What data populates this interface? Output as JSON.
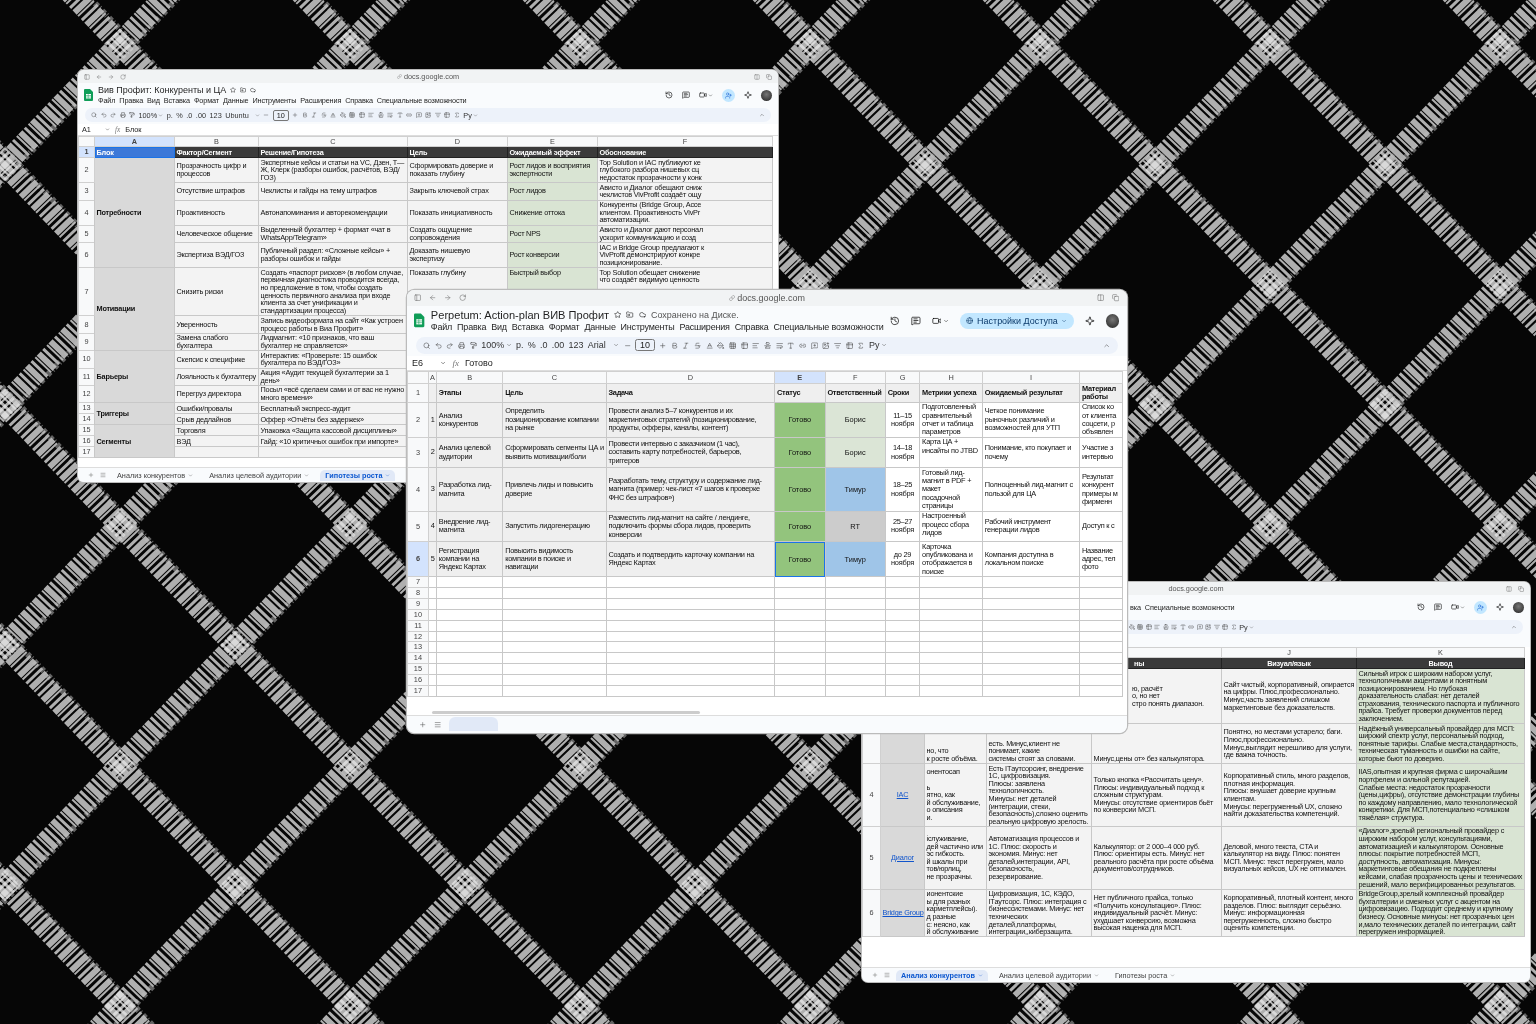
{
  "competitors_window": {
    "url": "docs.google.com",
    "title": "Вив Профит: Конкуренты и ЦА",
    "menu": [
      "Файл",
      "Правка",
      "Вид",
      "Вставка",
      "Формат",
      "Данные",
      "Инструменты",
      "Расширения",
      "Справка",
      "Специальные возможности"
    ],
    "toolbar": {
      "zoom": "100%",
      "formats": [
        "р.",
        "%",
        ".0",
        ".00",
        "123"
      ],
      "font": "Ubuntu",
      "size": "10",
      "input": "Ру"
    },
    "formula": {
      "cell": "A1",
      "function": "fx",
      "value": "Блок"
    },
    "columns": [
      {
        "letter": "A",
        "selected": true
      },
      {
        "letter": "B",
        "selected": false
      },
      {
        "letter": "C",
        "selected": false
      },
      {
        "letter": "D",
        "selected": false
      },
      {
        "letter": "E",
        "selected": false
      },
      {
        "letter": "F",
        "selected": false
      }
    ],
    "header": {
      "number": "1",
      "selected": true,
      "cells": [
        "Блок",
        "Фактор/Сегмент",
        "Решение/Гипотеза",
        "Цель",
        "Ожидаемый эффект",
        "Обоснование"
      ]
    },
    "groups": [
      {
        "block": "Потребности",
        "rows": [
          {
            "number": "2",
            "cells": [
              "Прозрачность цифр и процессов",
              "Экспертные кейсы и статьи на VC, Дзен, Т—Ж, Клерк (разборы ошибок, расчётов, ВЭД/ГОЗ)",
              "Сформировать доверие и показать глубину",
              "Рост лидов и восприятия экспертности",
              "Top Solution и IAC публикуют ке\nглубокого разбора нишевых сц\nнедостаток прозрачности у конк"
            ]
          },
          {
            "number": "3",
            "cells": [
              "Отсутствие штрафов",
              "Чеклисты и гайды на тему штрафов",
              "Закрыть ключевой страх",
              "Рост лидов",
              "Ависто и Диалог обещают сниж\nчеклистов VivProfit создаёт ощу"
            ]
          },
          {
            "number": "4",
            "cells": [
              "Проактивность",
              "Автонапоминания и авторекомендации",
              "Показать инициативность",
              "Снижение оттока",
              "Конкуренты (Bridge Group, Acce\nклиентом. Проактивность VivPr\nавтоматизации."
            ]
          },
          {
            "number": "5",
            "cells": [
              "Человеческое общение",
              "Выделенный бухгалтер + формат «чат в WhatsApp/Telegram»",
              "Создать ощущение сопровождения",
              "Рост NPS",
              "Ависто и Диалог дают персонал\nускорит коммуникацию и созд"
            ]
          },
          {
            "number": "6",
            "cells": [
              "Экспертиза ВЭД/ГОЗ",
              "Публичный раздел: «Сложные кейсы» + разборы ошибок и гайды",
              "Доказать нишевую экспертизу",
              "Рост конверсии",
              "IAC и Bridge Group предлагают к\nVivProfit демонстрируют конкре\nпозиционирование."
            ]
          }
        ]
      },
      {
        "block": "Мотивации",
        "rows": [
          {
            "number": "7",
            "cells": [
              "Снизить риски",
              "Создать «паспорт рисков» (в любом случае, первичная диагностика проводится всегда, но предложение в том, чтобы создать ценность первичного анализа при входе клиента за счет унификации и стандартизации процесса)",
              "Показать глубину",
              "Быстрый выбор",
              "Top Solution обещает снижение\nчто создаёт видимую ценность"
            ]
          },
          {
            "number": "8",
            "cells": [
              "Уверенность",
              "Запись видеоформата на сайт «Как устроен процесс работы в Виа Профит»"
            ]
          },
          {
            "number": "9",
            "cells": [
              "Замена слабого бухгалтера",
              "Лидмагнит: «10 признаков, что ваш бухгалтер не справляется»"
            ]
          }
        ]
      },
      {
        "block": "Барьеры",
        "rows": [
          {
            "number": "10",
            "cells": [
              "Скепсис к специфике",
              "Интерактив: «Проверьте: 15 ошибок бухгалтера по ВЭД/ГОЗ»"
            ]
          },
          {
            "number": "11",
            "cells": [
              "Лояльность к бухгалтеру",
              "Акция «Аудит текущей бухгалтерии за 1 день»"
            ]
          },
          {
            "number": "12",
            "cells": [
              "Перегруз директора",
              "Посыл «всё сделаем сами и от вас не нужно много времени»"
            ]
          }
        ]
      },
      {
        "block": "Триггеры",
        "rows": [
          {
            "number": "13",
            "cells": [
              "Ошибки/провалы",
              "Бесплатный экспресс-аудит"
            ]
          },
          {
            "number": "14",
            "cells": [
              "Срыв дедлайнов",
              "Оффер «Отчёты без задержек»"
            ]
          }
        ]
      },
      {
        "block": "Сегменты",
        "rows": [
          {
            "number": "15",
            "cells": [
              "Торговля",
              "Упаковка «Защита кассовой дисциплины»"
            ]
          },
          {
            "number": "16",
            "cells": [
              "ВЭД",
              "Гайд: «10 критичных ошибок при импорте»"
            ]
          },
          {
            "number": "17",
            "cells": []
          }
        ]
      }
    ],
    "tabs": [
      {
        "label": "Анализ конкурентов",
        "selected": false
      },
      {
        "label": "Анализ целевой аудитории",
        "selected": false
      },
      {
        "label": "Гипотезы роста",
        "selected": true
      }
    ]
  },
  "analysis_window": {
    "url": "docs.google.com",
    "menu": [
      "вка",
      "Специальные возможности"
    ],
    "toolbar": {
      "input": "Ру"
    },
    "column_letters": [
      "J",
      "K"
    ],
    "header": [
      "ны",
      "Визуал/язык",
      "Вывод"
    ],
    "rows": [
      {
        "cells": [
          null,
          null,
          "ю, расчёт\nо, но нет\nстро понять диапазон.",
          "Сайт чистый, корпоративный, опирается на цифры. Плюс,профессионально. Минус,часть заявлений слишком маркетинговые без доказательств.",
          "Сильный игрок с широким набором услуг, технологичными акцентами и понятным позиционированием. Но глубокая доказательность слабая: нет деталей страхования, технического паспорта и публичного прайса. Требует проверки документов перед заключением."
        ]
      },
      {
        "cells": [
          "но, что\nк росте объёма.",
          "есть. Минус,клиент не понимает, какие\nсистемы стоят за словами.",
          "Минус,цены от» без калькулятора.",
          "Понятно, но местами устарело; баги. Плюс,профессионально. Минус,выглядит нерешливо для услуги, где важна точность.",
          "Надёжный универсальный провайдер для МСП: широкий спектр услуг, персональный подход, понятные тарифы. Слабые места,стандартность, техническая туманность и ошибки на сайте, которые бьют по доверию."
        ]
      },
      {
        "number": "4",
        "name": "IAC",
        "cells": [
          "онентосап\n\nь\nятно, как\nй обслуживание,\nо описания\nи.",
          "Есть ITаутсорсинг, внедрение 1С, цифровизация.\nПлюсы: заявлена технологичность.\nМинусы: нет деталей (интеграции, стеки, безопасность),сложно оценить реальную цифровую зрелость.",
          "Только кнопка «Рассчитать цену».\nПлюсы: индивидуальный подход к сложным структурам.\nМинусы: отсутствие ориентиров бьёт по конверсии МСП.",
          "Корпоративный стиль, много разделов, плотная информация.\nПлюсы: внушает доверие крупным клиентам.\nМинусы: перегруженный UX, сложно найти доказательства компетенций.",
          "IIAS,опытная и крупная фирма с широчайшим портфелем и сильной репутацией.\nСлабые места: недостаток прозрачности (цены,цифры), отсутствие демонстрации глубины по каждому направлению, мало технологической конкретики. Для МСП,потенциально «слишком тяжёлая» структура."
        ]
      },
      {
        "number": "5",
        "name": "Диалог",
        "cells": [
          "іслуживание,\nдей частично или\nэс гибкость.\nй шкалы при\nтов/юрлиц,\nне прозрачны.",
          "Автоматизация процессов и 1С. Плюс: скорость и экономия. Минус: нет деталей,интеграции, API, безопасность, резервирование.",
          "Калькулятор: от 2 000–4 000 руб. Плюс: ориентиры есть. Минус: нет реального расчёта при росте объёма документов/сотрудников.",
          "Деловой, много текста, CTA и калькулятор на виду. Плюс: понятен МСП. Минус: текст перегружен, мало визуальных кейсов, UX не оптимален.",
          "«Диалог»,зрелый региональный провайдер с широким набором услуг, консультациями, автоматизацией и калькулятором. Основные плюсы: покрытие потребностей МСП, доступность, автоматизация. Минусы: маркетинговые обещания не подкреплены кейсами, слабая прозрачность цены и технических решений, мало верифицированных результатов."
        ]
      },
      {
        "number": "6",
        "name": "Bridge Group",
        "cells": [
          "ионентские\nы для разных\nкарметплейсы).\nд разные\nс: неясно, как\nй обслуживание",
          "Цифровизация, 1С, КЭДО, ITаутсорс. Плюс: интеграция с бизнессистемами. Минус: нет технических деталей,платформы, интеграции,,киберзащита.",
          "Нет публичного прайса, только «Получить консультацию». Плюс: индивидуальный расчёт. Минус: ухудшает конверсию, возможна высокая наценка для МСП.",
          "Корпоративный, плотный контент, много разделов. Плюс: выглядит серьёзно. Минус: информационная перегруженность, сложно быстро оценить компетенции.",
          "BridgeGroup,зрелый комплексный провайдер бухгалтерии и смежных услуг с акцентом на цифровизацию. Подходит среднему и крупному бизнесу. Основные минусы: нет прозрачных цен и,мало технических деталей по интеграции, сайт перегружен информацией."
        ]
      }
    ],
    "tabs": [
      {
        "label": "Анализ конкурентов",
        "selected": true
      },
      {
        "label": "Анализ целевой аудитории",
        "selected": false
      },
      {
        "label": "Гипотезы роста",
        "selected": false
      }
    ]
  },
  "action_plan_window": {
    "url": "docs.google.com",
    "title": "Perpetum: Action-plan ВИВ Профит",
    "saved": "Сохранено на Диске.",
    "menu": [
      "Файл",
      "Правка",
      "Вид",
      "Вставка",
      "Формат",
      "Данные",
      "Инструменты",
      "Расширения",
      "Справка",
      "Специальные возможности"
    ],
    "share": "Настройки Доступа",
    "toolbar": {
      "zoom": "100%",
      "formats": [
        "р.",
        "%",
        ".0",
        ".00",
        "123"
      ],
      "font": "Arial",
      "size": "10",
      "input": "Ру"
    },
    "formula": {
      "cell": "E6",
      "function": "fx",
      "value": "Готово"
    },
    "columns": [
      {
        "letter": "A",
        "selected": false
      },
      {
        "letter": "B",
        "selected": false
      },
      {
        "letter": "C",
        "selected": false
      },
      {
        "letter": "D",
        "selected": false
      },
      {
        "letter": "E",
        "selected": true
      },
      {
        "letter": "F",
        "selected": false
      },
      {
        "letter": "G",
        "selected": false
      },
      {
        "letter": "H",
        "selected": false
      },
      {
        "letter": "I",
        "selected": false
      }
    ],
    "header": {
      "number": "1",
      "cells": [
        "Этапы",
        "Цель",
        "Задача",
        "Статус",
        "Ответственный",
        "Сроки",
        "Метрики успеха",
        "Ожидаемый результат",
        "Материал\nработы"
      ]
    },
    "rows": [
      {
        "number": "2",
        "selected": false,
        "index": "1",
        "stage": "Анализ конкурентов",
        "goal": "Определить позиционирование компании на рынке",
        "task": "Провести анализ 5–7 конкурентов и их маркетинговых стратегий (позиционирование, продукты, офферы, каналы, контент)",
        "status": {
          "text": "Готово",
          "color": "#93c47d"
        },
        "owner": {
          "text": "Борис",
          "color": "#dbe5d6"
        },
        "term": "11–15 ноября",
        "metric": "Подготовленный сравнительный отчет и таблица параметров",
        "result": "Четкое понимание рыночных различий и возможностей для УТП",
        "materials": "Список ко\nот клиента\nсоцсети, р\nобъявлен"
      },
      {
        "number": "3",
        "selected": false,
        "index": "2",
        "stage": "Анализ целевой аудитории",
        "goal": "Сформировать сегменты ЦА и выявить мотивации/боли",
        "task": "Провести интервью с заказчиком (1 час), составить карту потребностей, барьеров, триггеров",
        "status": {
          "text": "Готово",
          "color": "#93c47d"
        },
        "owner": {
          "text": "Борис",
          "color": "#dbe5d6"
        },
        "term": "14–18 ноября",
        "metric": "Карта ЦА + инсайты по JTBD",
        "result": "Понимание, кто покупает и почему",
        "materials": "Участие з\nинтервью"
      },
      {
        "number": "4",
        "selected": false,
        "index": "3",
        "stage": "Разработка лид-магнита",
        "goal": "Привлечь лиды и повысить доверие",
        "task": "Разработать тему, структуру и содержание лид-магнита (пример: чек-лист «7 шагов к проверке ФНС без штрафов»)",
        "status": {
          "text": "Готово",
          "color": "#93c47d"
        },
        "owner": {
          "text": "Тимур",
          "color": "#9fc5e8"
        },
        "term": "18–25 ноября",
        "metric": "Готовый лид-магнит в PDF + макет посадочной страницы",
        "result": "Полноценный лид-магнит с пользой для ЦА",
        "materials": "Результат\nконкурент\nпримеры м\nфирменн"
      },
      {
        "number": "5",
        "selected": false,
        "index": "4",
        "stage": "Внедрение лид-магнита",
        "goal": "Запустить лидогенерацию",
        "task": "Разместить лид-магнит на сайте / лендинге, подключить формы сбора лидов, проверить конверсии",
        "status": {
          "text": "Готово",
          "color": "#93c47d"
        },
        "owner": {
          "text": "RT",
          "color": "#cccccc"
        },
        "term": "25–27 ноября",
        "metric": "Настроенный процесс сбора лидов",
        "result": "Рабочий инструмент генерации лидов",
        "materials": "Доступ к с"
      },
      {
        "number": "6",
        "selected": true,
        "index": "5",
        "stage": "Регистрация компании на Яндекс Картах",
        "goal": "Повысить видимость компании в поиске и навигации",
        "task": "Создать и подтвердить карточку компании на Яндекс Картах",
        "status": {
          "text": "Готово",
          "color": "#93c47d"
        },
        "owner": {
          "text": "Тимур",
          "color": "#9fc5e8"
        },
        "term": "до 29 ноября",
        "metric": "Карточка опубликована и отображается в поиске",
        "result": "Компания доступна в локальном поиске",
        "materials": "Название\nадрес, тел\nфото"
      }
    ],
    "empty_rows": [
      "7",
      "8",
      "9",
      "10",
      "11",
      "12",
      "13",
      "14",
      "15",
      "16",
      "17"
    ],
    "tabs": [
      {
        "selected": true
      }
    ]
  }
}
